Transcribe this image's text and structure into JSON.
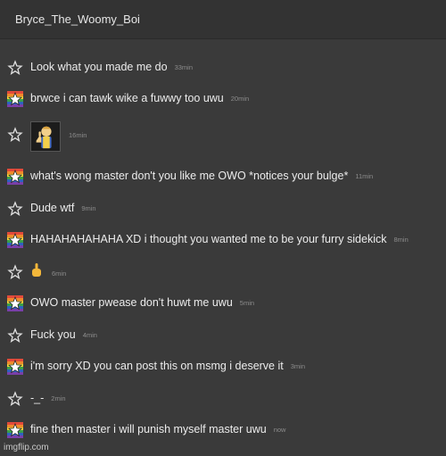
{
  "header": {
    "username": "Bryce_The_Woomy_Boi"
  },
  "messages": [
    {
      "avatar": "star",
      "text": "Look what you made me do",
      "time": "33min"
    },
    {
      "avatar": "flag",
      "text": "brwce i can tawk wike a fuwwy too uwu",
      "time": "20min"
    },
    {
      "avatar": "star",
      "text": "",
      "time": "16min",
      "kind": "image",
      "image": "vault-boy-thumbs-up"
    },
    {
      "avatar": "flag",
      "text": "what's wong master don't you like me OWO *notices your bulge*",
      "time": "11min"
    },
    {
      "avatar": "star",
      "text": "Dude wtf",
      "time": "9min"
    },
    {
      "avatar": "flag",
      "text": "HAHAHAHAHAHA XD i thought you wanted me to be your furry sidekick",
      "time": "8min"
    },
    {
      "avatar": "star",
      "text": "",
      "time": "6min",
      "kind": "emoji",
      "image": "middle-finger-emoji"
    },
    {
      "avatar": "flag",
      "text": "OWO master pwease don't huwt me uwu",
      "time": "5min"
    },
    {
      "avatar": "star",
      "text": "Fuck you",
      "time": "4min"
    },
    {
      "avatar": "flag",
      "text": "i'm sorry XD you can post this on msmg i deserve it",
      "time": "3min"
    },
    {
      "avatar": "star",
      "text": "-_-",
      "time": "2min"
    },
    {
      "avatar": "flag",
      "text": "fine then master i will punish myself master uwu",
      "time": "now"
    }
  ],
  "footer": {
    "watermark": "imgflip.com"
  },
  "colors": {
    "background": "#3a3a3a",
    "header": "#333333",
    "text": "#ececec",
    "timestamp": "#8c8c8c"
  }
}
